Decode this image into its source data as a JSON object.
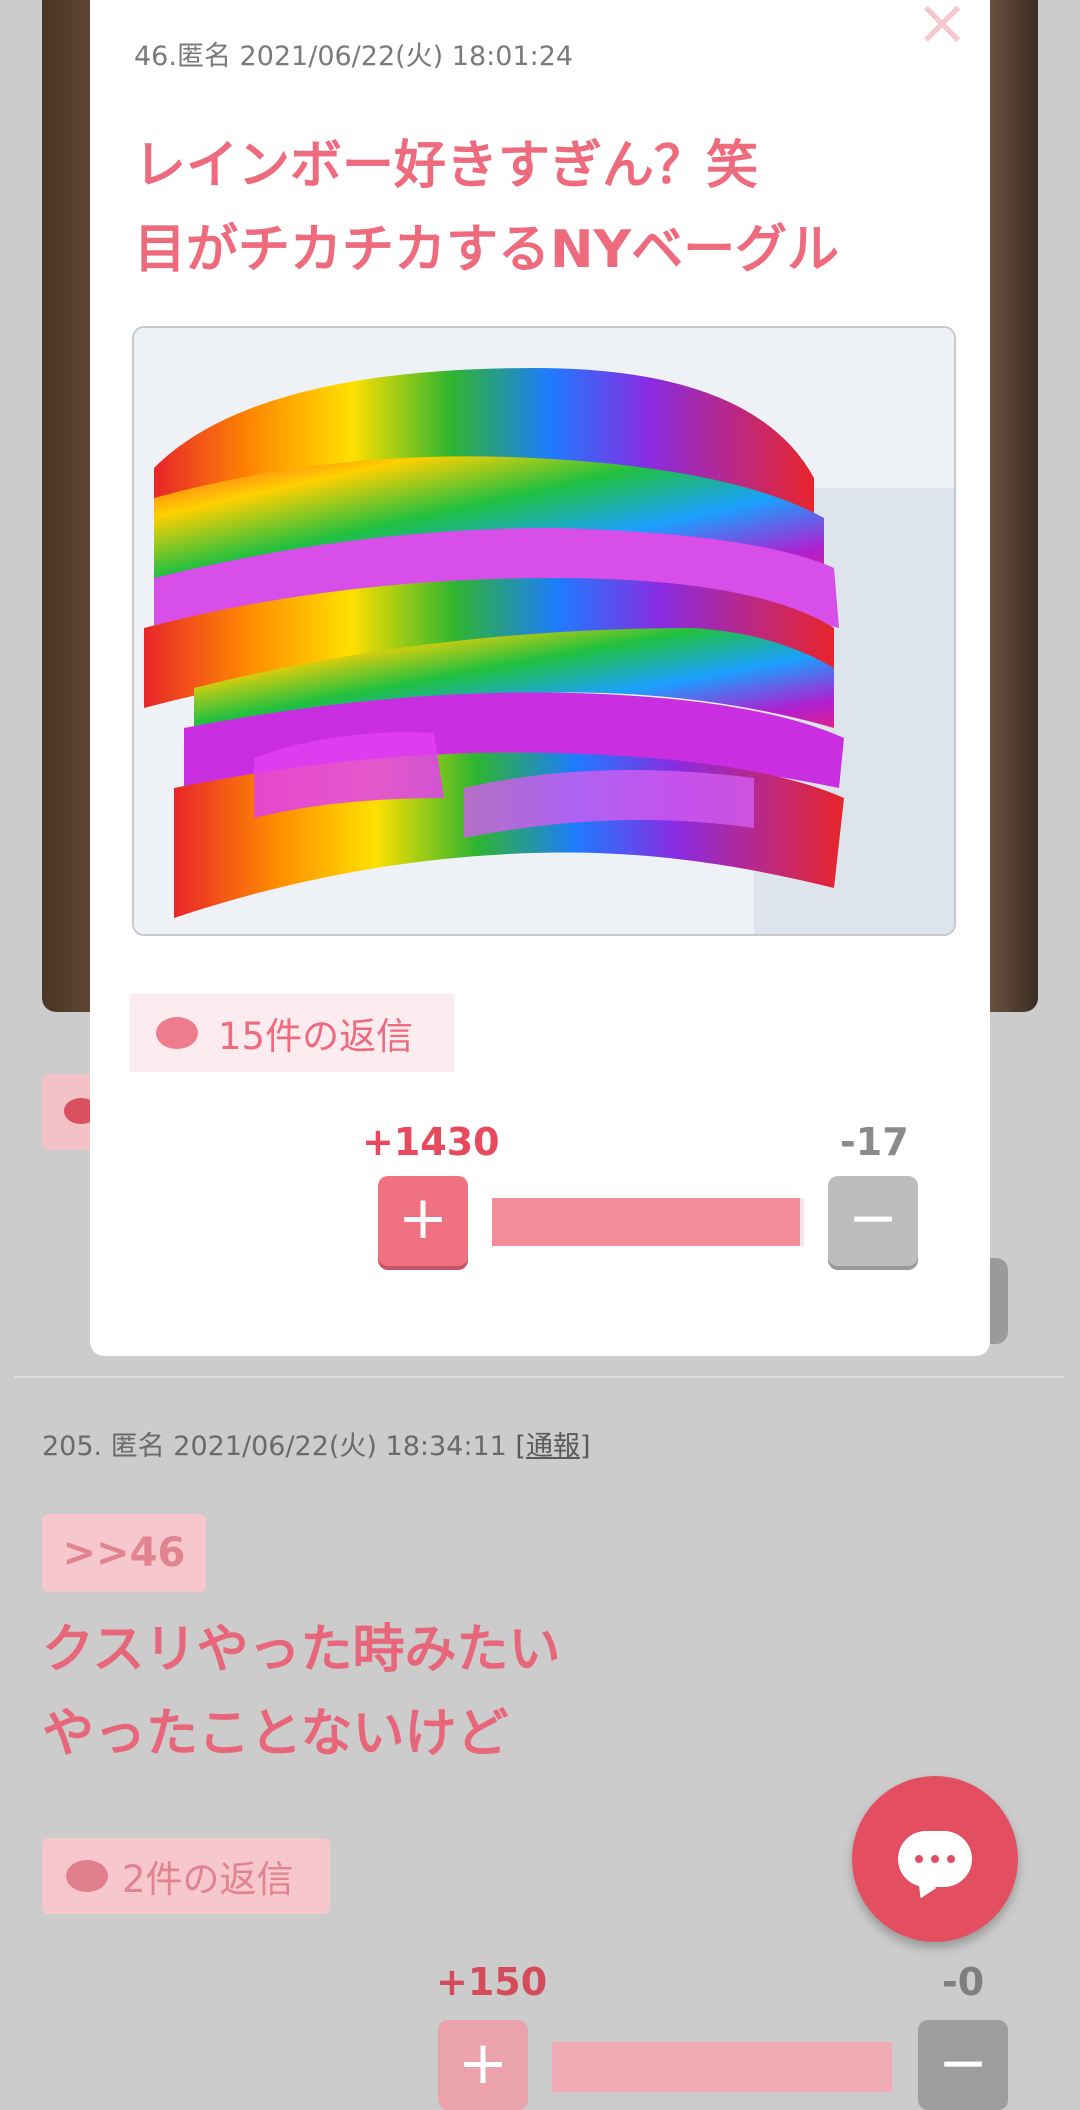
{
  "modal": {
    "meta": "46.匿名 2021/06/22(火) 18:01:24",
    "title_line1": "レインボー好きすぎん？笑",
    "title_line2": "目がチカチカするNYベーグル",
    "image_alt": "rainbow bagel photo",
    "replies_label": "15件の返信",
    "vote_plus": "+1430",
    "vote_minus": "-17",
    "plus_symbol": "+",
    "minus_symbol": "−",
    "close_symbol": "×",
    "positive_ratio": 0.988
  },
  "comment": {
    "meta_text": "205. 匿名 2021/06/22(火) 18:34:11 ",
    "report_label": "[通報]",
    "anchor": ">>46",
    "body_line1": "クスリやった時みたい",
    "body_line2": "やったことないけど",
    "replies_label": "2件の返信",
    "vote_plus": "+150",
    "vote_minus": "-0",
    "plus_symbol": "+",
    "minus_symbol": "−"
  },
  "colors": {
    "accent": "#ee6a7d",
    "fab": "#e34f61",
    "overlay_bg": "#cccccc"
  },
  "icons": {
    "close": "close-icon",
    "reply": "speech-bubble-icon",
    "fab": "chat-bubble-icon"
  }
}
